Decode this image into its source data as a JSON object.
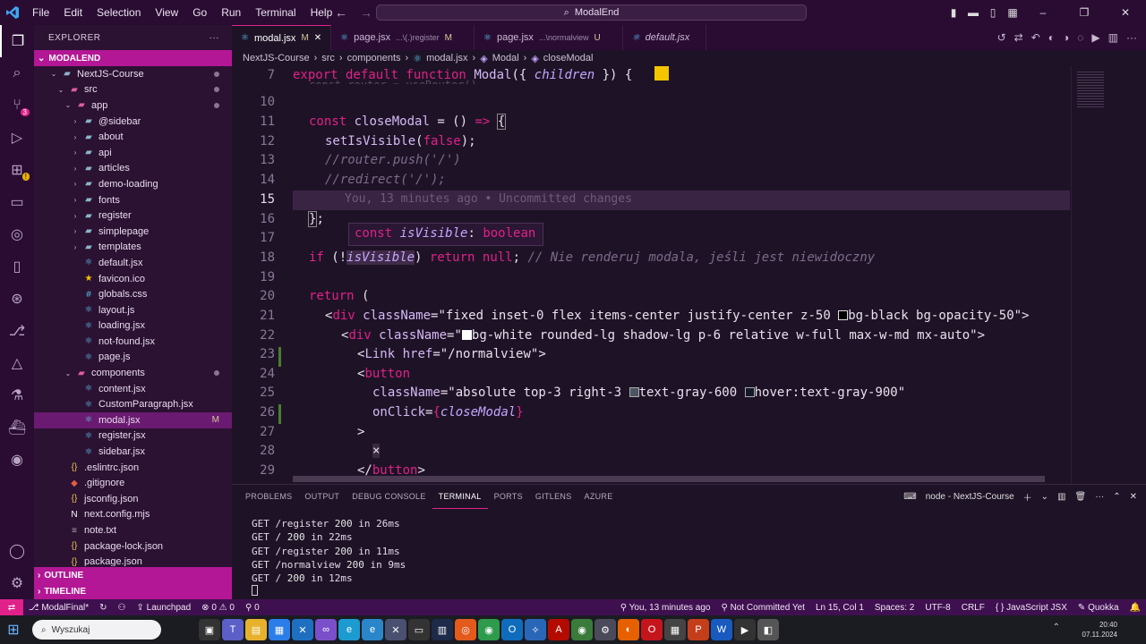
{
  "titlebar": {
    "menu": [
      "File",
      "Edit",
      "Selection",
      "View",
      "Go",
      "Run",
      "Terminal",
      "Help"
    ],
    "search_text": "ModalEnd"
  },
  "explorer": {
    "header": "EXPLORER",
    "section": "MODALEND",
    "items": [
      {
        "label": "NextJS-Course",
        "depth": 1,
        "type": "folder-open",
        "flag": "dot"
      },
      {
        "label": "src",
        "depth": 2,
        "type": "folder-open",
        "flag": "dot"
      },
      {
        "label": "app",
        "depth": 3,
        "type": "folder-open",
        "flag": "dot"
      },
      {
        "label": "@sidebar",
        "depth": 4,
        "type": "folder"
      },
      {
        "label": "about",
        "depth": 4,
        "type": "folder"
      },
      {
        "label": "api",
        "depth": 4,
        "type": "folder"
      },
      {
        "label": "articles",
        "depth": 4,
        "type": "folder"
      },
      {
        "label": "demo-loading",
        "depth": 4,
        "type": "folder"
      },
      {
        "label": "fonts",
        "depth": 4,
        "type": "folder"
      },
      {
        "label": "register",
        "depth": 4,
        "type": "folder"
      },
      {
        "label": "simplepage",
        "depth": 4,
        "type": "folder"
      },
      {
        "label": "templates",
        "depth": 4,
        "type": "folder"
      },
      {
        "label": "default.jsx",
        "depth": 4,
        "type": "jsx"
      },
      {
        "label": "favicon.ico",
        "depth": 4,
        "type": "ico"
      },
      {
        "label": "globals.css",
        "depth": 4,
        "type": "css"
      },
      {
        "label": "layout.js",
        "depth": 4,
        "type": "jsx"
      },
      {
        "label": "loading.jsx",
        "depth": 4,
        "type": "jsx"
      },
      {
        "label": "not-found.jsx",
        "depth": 4,
        "type": "jsx"
      },
      {
        "label": "page.js",
        "depth": 4,
        "type": "jsx"
      },
      {
        "label": "components",
        "depth": 3,
        "type": "folder-open",
        "flag": "dot"
      },
      {
        "label": "content.jsx",
        "depth": 4,
        "type": "jsx"
      },
      {
        "label": "CustomParagraph.jsx",
        "depth": 4,
        "type": "jsx"
      },
      {
        "label": "modal.jsx",
        "depth": 4,
        "type": "jsx",
        "flag": "M",
        "selected": true
      },
      {
        "label": "register.jsx",
        "depth": 4,
        "type": "jsx"
      },
      {
        "label": "sidebar.jsx",
        "depth": 4,
        "type": "jsx"
      },
      {
        "label": ".eslintrc.json",
        "depth": 2,
        "type": "json"
      },
      {
        "label": ".gitignore",
        "depth": 2,
        "type": "git"
      },
      {
        "label": "jsconfig.json",
        "depth": 2,
        "type": "json"
      },
      {
        "label": "next.config.mjs",
        "depth": 2,
        "type": "next"
      },
      {
        "label": "note.txt",
        "depth": 2,
        "type": "txt"
      },
      {
        "label": "package-lock.json",
        "depth": 2,
        "type": "json"
      },
      {
        "label": "package.json",
        "depth": 2,
        "type": "json"
      }
    ],
    "outline": "OUTLINE",
    "timeline": "TIMELINE"
  },
  "tabs": [
    {
      "label": "modal.jsx",
      "flag": "M",
      "sub": "",
      "active": true
    },
    {
      "label": "page.jsx",
      "flag": "M",
      "sub": "...\\(.)register",
      "active": false
    },
    {
      "label": "page.jsx",
      "flag": "U",
      "sub": "...\\normalview",
      "active": false
    },
    {
      "label": "default.jsx",
      "flag": "",
      "sub": "",
      "active": false,
      "italic": true
    }
  ],
  "breadcrumb": [
    "NextJS-Course",
    "src",
    "components",
    "modal.jsx",
    "Modal",
    "closeModal"
  ],
  "editor": {
    "blame": "You, 13 minutes ago • Uncommitted changes",
    "hover": {
      "kw": "const",
      "name": "isVisible",
      "sep": ":",
      "type": "boolean"
    }
  },
  "panel": {
    "tabs": [
      "PROBLEMS",
      "OUTPUT",
      "DEBUG CONSOLE",
      "TERMINAL",
      "PORTS",
      "GITLENS",
      "AZURE"
    ],
    "active_tab": "TERMINAL",
    "terminal_name": "node - NextJS-Course",
    "lines": [
      {
        "pre": "GET /register ",
        "code": "200",
        "post": " in 26ms"
      },
      {
        "pre": "GET / ",
        "code": "200",
        "post": " in 22ms"
      },
      {
        "pre": "GET /register ",
        "code": "200",
        "post": " in 11ms"
      },
      {
        "pre": "GET /normalview ",
        "code": "200",
        "post": " in 9ms"
      },
      {
        "pre": "GET / ",
        "code": "200",
        "post": " in 12ms"
      }
    ]
  },
  "statusbar": {
    "branch": "ModalFinal*",
    "launchpad": "Launchpad",
    "errors": "0",
    "warnings": "0",
    "ports": "0",
    "blame": "You, 13 minutes ago",
    "commit": "Not Committed Yet",
    "position": "Ln 15, Col 1",
    "spaces": "Spaces: 2",
    "encoding": "UTF-8",
    "eol": "CRLF",
    "language": "JavaScript JSX",
    "extension": "Quokka"
  },
  "taskbar": {
    "search_placeholder": "Wyszukaj",
    "time": "20:40",
    "date": "07.11.2024"
  },
  "colors": {
    "accent": "#e0218a",
    "titlebar": "#2a0c33",
    "statusbar": "#3f1050"
  }
}
